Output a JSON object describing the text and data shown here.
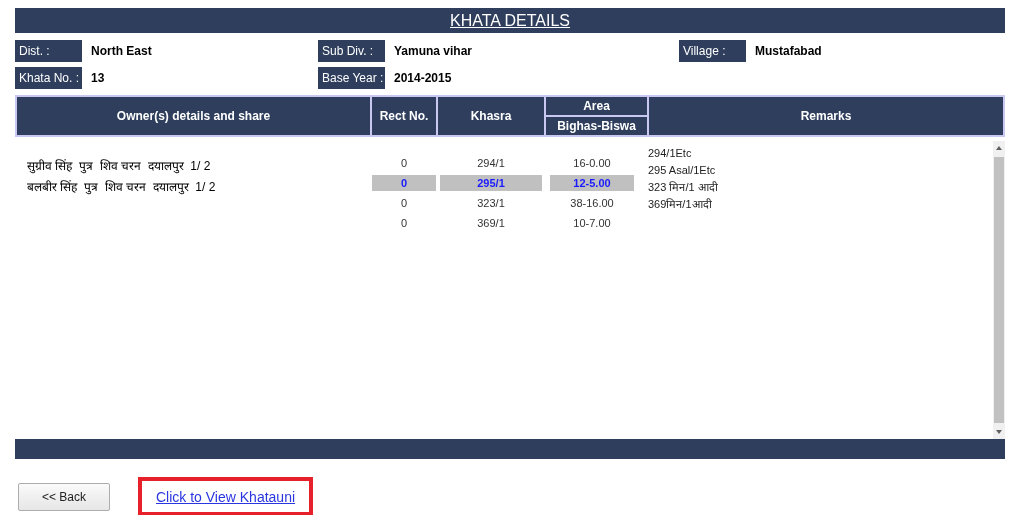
{
  "title": "KHATA DETAILS",
  "info": [
    [
      {
        "label": "Dist. :",
        "value": "North East"
      },
      {
        "label": "Sub Div. :",
        "value": "Yamuna vihar"
      },
      {
        "label": "Village :",
        "value": "Mustafabad"
      }
    ],
    [
      {
        "label": "Khata No. :",
        "value": "13"
      },
      {
        "label": "Base Year :",
        "value": "2014-2015"
      }
    ]
  ],
  "table": {
    "columns": [
      {
        "label": "Owner(s) details and share"
      },
      {
        "label": "Rect No."
      },
      {
        "label": "Khasra"
      },
      {
        "label": "Area",
        "sub": "Bighas-Biswa"
      },
      {
        "label": "Remarks"
      }
    ],
    "owners": [
      "सुग्रीव सिंह  पुत्र  शिव चरन  दयालपुर  1/ 2",
      "बलबीर सिंह  पुत्र  शिव चरन  दयालपुर  1/ 2"
    ],
    "rows": [
      {
        "rect_no": "0",
        "khasra": "294/1",
        "area": "16-0.00",
        "selected": false
      },
      {
        "rect_no": "0",
        "khasra": "295/1",
        "area": "12-5.00",
        "selected": true
      },
      {
        "rect_no": "0",
        "khasra": "323/1",
        "area": "38-16.00",
        "selected": false
      },
      {
        "rect_no": "0",
        "khasra": "369/1",
        "area": "10-7.00",
        "selected": false
      }
    ],
    "remarks": [
      "294/1Etc",
      "295 Asal/1Etc",
      "323 मिन/1 आदी",
      "369मिन/1आदी"
    ]
  },
  "back_button": "<< Back",
  "link": {
    "label": "Click to View Khatauni",
    "highlighted": true
  }
}
